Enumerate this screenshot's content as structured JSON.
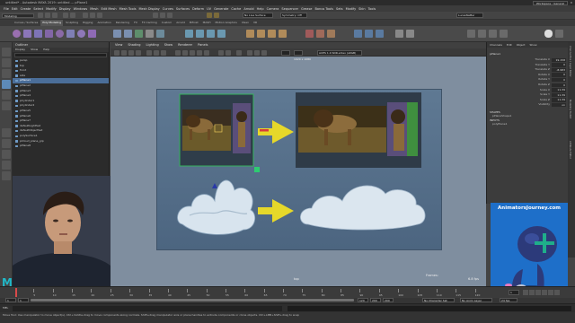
{
  "window": {
    "title": "untitled* - Autodesk MAYA 2019: untitled   ---   pPlane1",
    "workspace_label": "Workspace :",
    "workspace_value": "General"
  },
  "menubar": [
    "File",
    "Edit",
    "Create",
    "Select",
    "Modify",
    "Display",
    "Windows",
    "Mesh",
    "Edit Mesh",
    "Mesh Tools",
    "Mesh Display",
    "Curves",
    "Surfaces",
    "Deform",
    "UV",
    "Generate",
    "Cache",
    "Arnold",
    "Help",
    "Camera",
    "Sequencer",
    "Grease",
    "Bonus Tools",
    "Sets",
    "Modify",
    "Skin",
    "Tools"
  ],
  "statusline": {
    "mode": "Modeling",
    "no_live": "No Live Surface",
    "symmetry": "Symmetry: Off",
    "user": "LucasNaMar"
  },
  "shelf_tabs": [
    "Curves / Surfaces",
    "Poly Modeling",
    "Sculpting",
    "Rigging",
    "Animation",
    "Rendering",
    "FX",
    "FX Caching",
    "Custom",
    "Arnold",
    "Bifrost",
    "MASH",
    "Motion Graphics",
    "XGen",
    "VR"
  ],
  "active_shelf_tab": "Poly Modeling",
  "outliner": {
    "title": "Outliner",
    "menus": [
      "Display",
      "Show",
      "Help"
    ],
    "items": [
      {
        "label": "persp",
        "selected": false
      },
      {
        "label": "top",
        "selected": false
      },
      {
        "label": "front",
        "selected": false
      },
      {
        "label": "side",
        "selected": false
      },
      {
        "label": "pPlane1",
        "selected": true
      },
      {
        "label": "pPlane2",
        "selected": false
      },
      {
        "label": "pPlane3",
        "selected": false
      },
      {
        "label": "pPlane4",
        "selected": false
      },
      {
        "label": "pCylinder1",
        "selected": false
      },
      {
        "label": "pCylinder2",
        "selected": false
      },
      {
        "label": "pPlane5",
        "selected": false
      },
      {
        "label": "pPlane6",
        "selected": false
      },
      {
        "label": "pPlane7",
        "selected": false
      },
      {
        "label": "defaultLightSet",
        "selected": false
      },
      {
        "label": "defaultObjectSet",
        "selected": false
      },
      {
        "label": "polySurface1",
        "selected": false
      },
      {
        "label": "pCloud_plane_grp",
        "selected": false
      },
      {
        "label": "pPlane8",
        "selected": false
      }
    ]
  },
  "viewport": {
    "menus": [
      "View",
      "Shading",
      "Lighting",
      "Show",
      "Renderer",
      "Panels"
    ],
    "camera_label": "top",
    "fps": "6.8 fps",
    "res_label": "1920 x 1080",
    "frame_label": "Frames:",
    "gate_field": "ACES 1.0 SDR-video (sRGB)"
  },
  "channelbox": {
    "tabs": [
      "Channels",
      "Edit",
      "Object",
      "Show"
    ],
    "object_name": "pPlane1",
    "attributes": [
      {
        "label": "Translate X",
        "value": "19.158"
      },
      {
        "label": "Translate Y",
        "value": "0"
      },
      {
        "label": "Translate Z",
        "value": "-8.983"
      },
      {
        "label": "Rotate X",
        "value": "0"
      },
      {
        "label": "Rotate Y",
        "value": "0"
      },
      {
        "label": "Rotate Z",
        "value": "0"
      },
      {
        "label": "Scale X",
        "value": "11.39"
      },
      {
        "label": "Scale Y",
        "value": "11.39"
      },
      {
        "label": "Scale Z",
        "value": "11.39"
      },
      {
        "label": "Visibility",
        "value": "on"
      }
    ],
    "shapes_header": "SHAPES",
    "shape_name": "pPlaneShape1",
    "inputs_header": "INPUTS",
    "input_name": "polyPlane1"
  },
  "right_strip": [
    "Channel Box / Layer Editor",
    "Modeling Toolkit",
    "Attribute Editor"
  ],
  "ad": {
    "text": "AnimatorsJourney.com",
    "colors": {
      "bg": "#1e6fc9",
      "body": "#2c3a7a",
      "cross": "#1fae8a"
    }
  },
  "timeline": {
    "ticks": [
      "5",
      "10",
      "15",
      "20",
      "25",
      "30",
      "35",
      "40",
      "45",
      "50",
      "55",
      "60",
      "65",
      "70",
      "75",
      "80",
      "85",
      "90",
      "95",
      "100",
      "105",
      "110",
      "115",
      "120"
    ],
    "range_start": "1",
    "range_inner_start": "1",
    "range_end": "120",
    "range_outer_end": "200",
    "range_end2": "200",
    "current_frame": "1",
    "no_char_set": "No Character Set",
    "no_anim_layer": "No Anim Layer",
    "fps_setting": "24 fps"
  },
  "helpline": {
    "text": "Move Tool: Use manipulator to move object(s). Ctrl+middle-drag to move components along normals. Shift+drag manipulator axis or plane handles to extrude components or clone objects. Ctrl+LMB+Shift+drag to snap"
  },
  "cmdline": {
    "mel_label": "MEL"
  },
  "logo_letter": "M"
}
